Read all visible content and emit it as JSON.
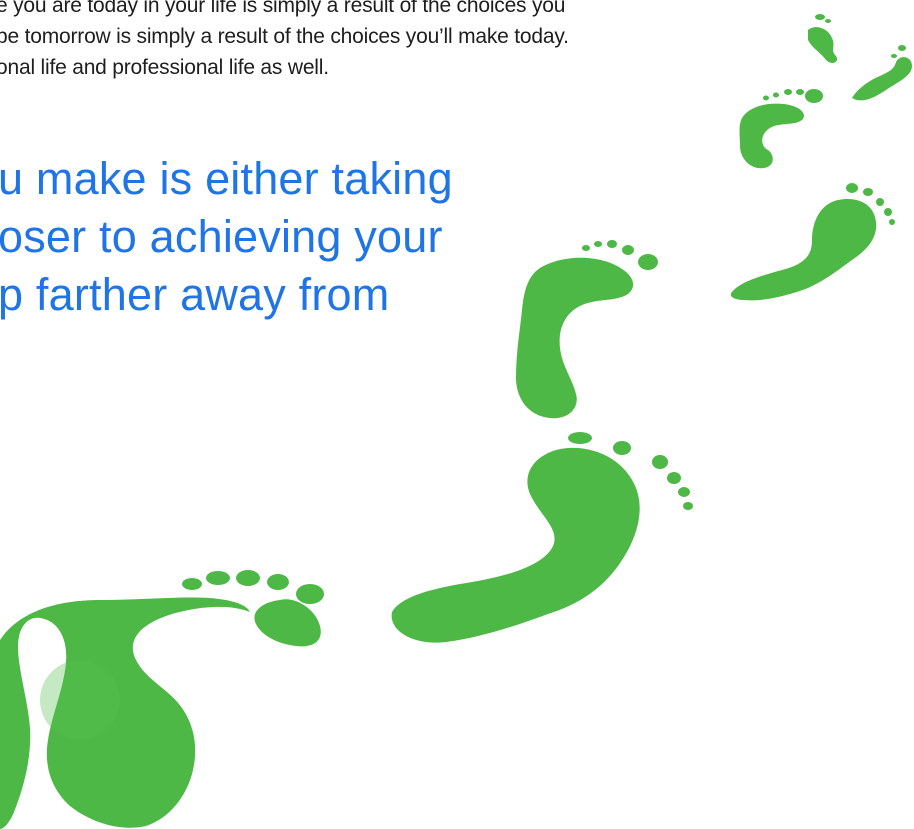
{
  "body_text": {
    "line1": "e you are today in your life is simply a result of the choices you",
    "line2": "be tomorrow is simply a result of the choices you’ll make today.",
    "line3": "onal life and professional life as well."
  },
  "quote": {
    "line1": "u make is either taking",
    "line2": "oser to achieving your",
    "line3": "p farther away from"
  },
  "colors": {
    "quote": "#1f74e6",
    "body": "#1e1e1e",
    "footprint": "#4db845"
  },
  "graphic": {
    "name": "green-footprints-trail"
  }
}
